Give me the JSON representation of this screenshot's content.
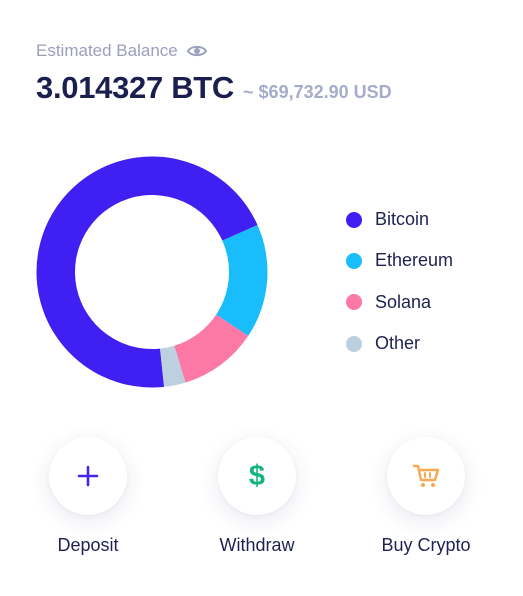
{
  "balance": {
    "label": "Estimated Balance",
    "amount": "3.014327 BTC",
    "fiat": "~ $69,732.90 USD",
    "visibility_icon": "eye-icon"
  },
  "portfolio": {
    "legend": [
      {
        "label": "Bitcoin",
        "color": "#3f1ff2"
      },
      {
        "label": "Ethereum",
        "color": "#19bdfb"
      },
      {
        "label": "Solana",
        "color": "#fb79a4"
      },
      {
        "label": "Other",
        "color": "#bcd0e0"
      }
    ],
    "allocation_percent": [
      70,
      16,
      11,
      3
    ]
  },
  "actions": [
    {
      "label": "Deposit",
      "icon": "plus-icon",
      "color": "#4527e8"
    },
    {
      "label": "Withdraw",
      "icon": "dollar-icon",
      "color": "#14b57b",
      "glyph": "$"
    },
    {
      "label": "Buy Crypto",
      "icon": "cart-icon",
      "color": "#f9a84f"
    }
  ]
}
